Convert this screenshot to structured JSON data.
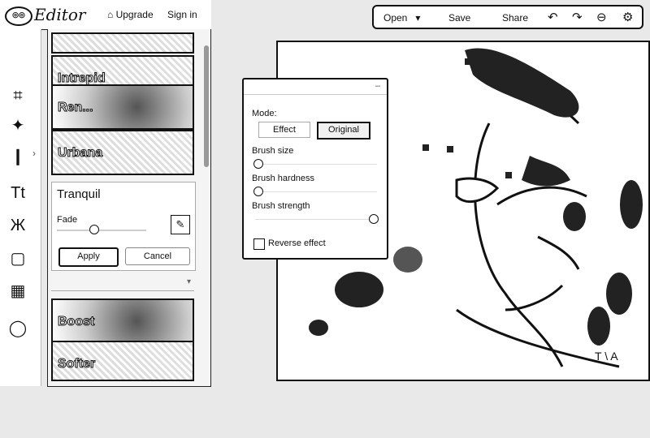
{
  "header": {
    "app_title": "Editor",
    "upgrade_label": "Upgrade",
    "signin_label": "Sign in"
  },
  "effects": {
    "thumbnails_top": [
      "Intrepid",
      "Ren...",
      "Urbana"
    ],
    "thumbnails_bottom": [
      "Boost",
      "Softer"
    ],
    "selected": {
      "name": "Tranquil",
      "fade_label": "Fade",
      "fade_level": 0.4,
      "apply_label": "Apply",
      "cancel_label": "Cancel"
    }
  },
  "toolbar": {
    "open_label": "Open",
    "save_label": "Save",
    "share_label": "Share"
  },
  "dialog": {
    "mode_label": "Mode:",
    "effect_label": "Effect",
    "original_label": "Original",
    "selected_mode": "Original",
    "brush_size_label": "Brush size",
    "brush_hardness_label": "Brush hardness",
    "brush_strength_label": "Brush strength",
    "reverse_label": "Reverse effect",
    "reverse_checked": false
  }
}
